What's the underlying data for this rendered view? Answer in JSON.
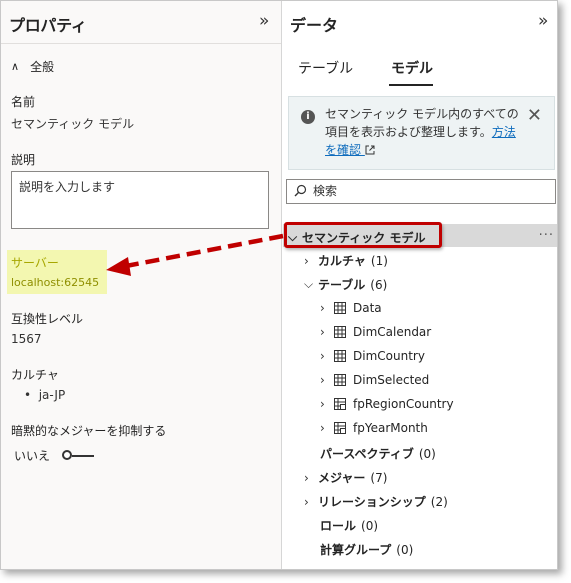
{
  "properties": {
    "title": "プロパティ",
    "collapse_glyph": "»",
    "section": {
      "label": "全般",
      "chevron": "∧"
    },
    "name_label": "名前",
    "name_value": "セマンティック モデル",
    "description_label": "説明",
    "description_placeholder": "説明を入力します",
    "server_label": "サーバー",
    "server_value": "localhost:62545",
    "compat_label": "互換性レベル",
    "compat_value": "1567",
    "culture_label": "カルチャ",
    "culture_value": "ja-JP",
    "implicit_label": "暗黙的なメジャーを抑制する",
    "implicit_value": "いいえ",
    "implicit_on": false
  },
  "data": {
    "title": "データ",
    "collapse_glyph": "»",
    "tabs": [
      {
        "label": "テーブル",
        "active": false
      },
      {
        "label": "モデル",
        "active": true
      }
    ],
    "info": {
      "text": "セマンティック モデル内のすべての項目を表示および整理します。",
      "link": "方法を確認",
      "close": "✕"
    },
    "search_placeholder": "検索",
    "tree": {
      "root": {
        "label": "セマンティック モデル",
        "more": "···"
      },
      "cultures": {
        "label": "カルチャ",
        "count": "(1)"
      },
      "tables": {
        "label": "テーブル",
        "count": "(6)"
      },
      "table_items": [
        "Data",
        "DimCalendar",
        "DimCountry",
        "DimSelected",
        "fpRegionCountry",
        "fpYearMonth"
      ],
      "perspectives": {
        "label": "パースペクティブ",
        "count": "(0)"
      },
      "measures": {
        "label": "メジャー",
        "count": "(7)"
      },
      "relationships": {
        "label": "リレーションシップ",
        "count": "(2)"
      },
      "roles": {
        "label": "ロール",
        "count": "(0)"
      },
      "calc_groups": {
        "label": "計算グループ",
        "count": "(0)"
      }
    }
  },
  "colors": {
    "highlight": "#f3f7b0",
    "callout": "#c00000",
    "link": "#0f6cbd",
    "selection": "#d9d9d9"
  }
}
